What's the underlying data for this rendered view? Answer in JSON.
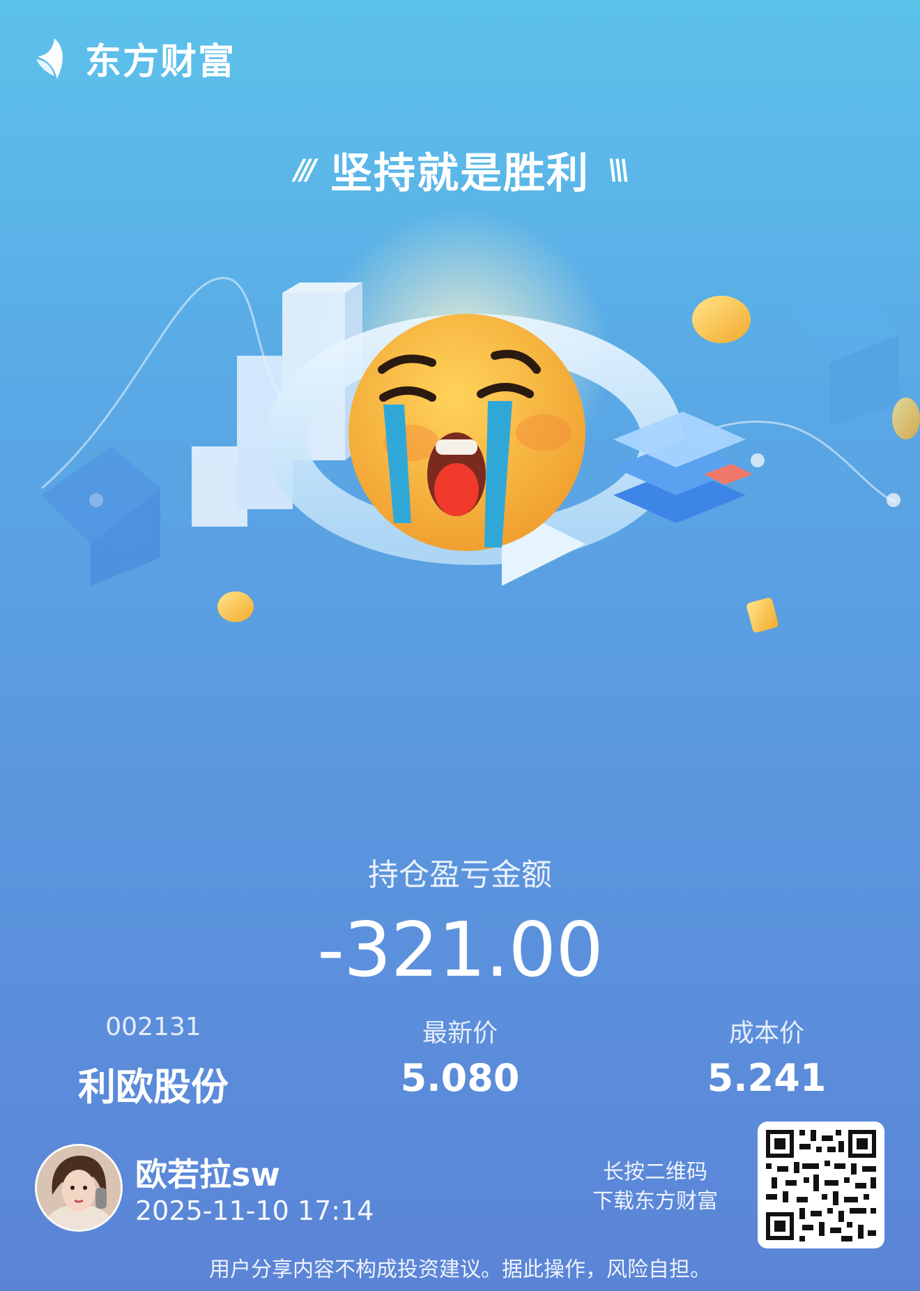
{
  "brand": {
    "name": "东方财富",
    "color": "#ffffff",
    "logo_icon": "eastmoney-logo-icon"
  },
  "slogan": "坚持就是胜利",
  "illustration": {
    "icon": "crying-emoji-icon"
  },
  "summary": {
    "label": "持仓盈亏金额",
    "amount": "-321.00"
  },
  "stock": {
    "code": "002131",
    "name": "利欧股份",
    "latest_price_label": "最新价",
    "latest_price": "5.080",
    "cost_price_label": "成本价",
    "cost_price": "5.241"
  },
  "user": {
    "name": "欧若拉sw",
    "datetime": "2025-11-10 17:14"
  },
  "qr_hint": {
    "line1": "长按二维码",
    "line2": "下载东方财富"
  },
  "disclaimer": "用户分享内容不构成投资建议。据此操作，风险自担。",
  "colors": {
    "background_top": "#5cc2ea",
    "background_bottom": "#5b84d6",
    "emoji_face": "#f5b13a",
    "tears": "#2fa8d8"
  }
}
